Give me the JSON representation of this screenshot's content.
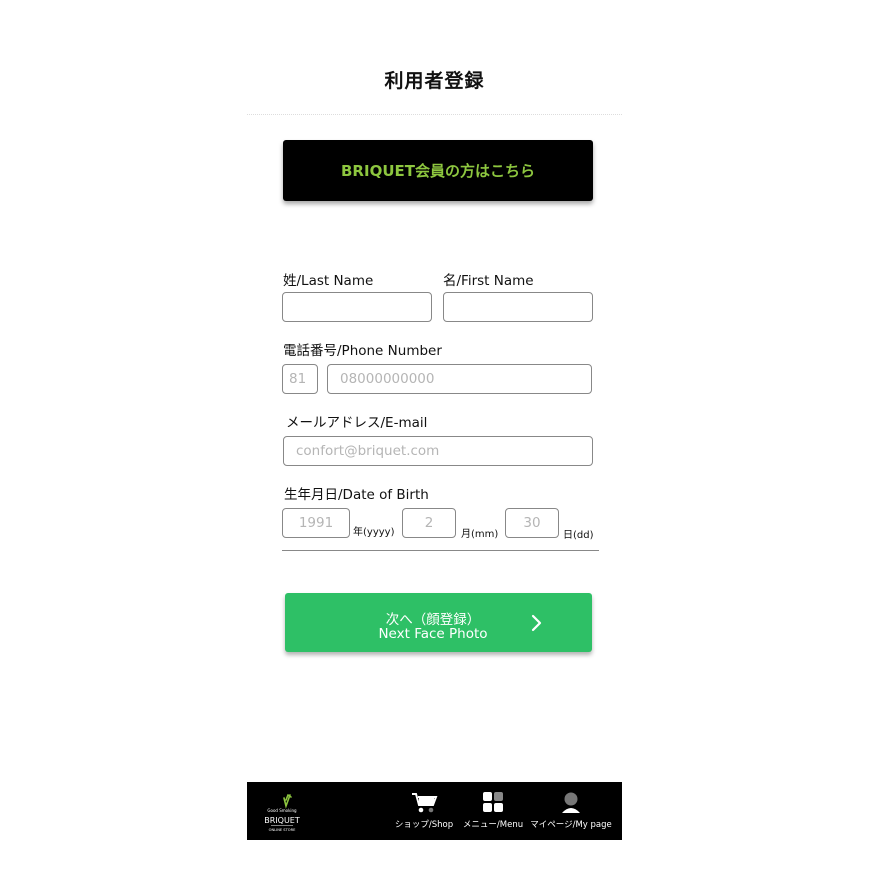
{
  "header": {
    "title": "利用者登録"
  },
  "member_button": {
    "label": "BRIQUET会員の方はこちら"
  },
  "form": {
    "last_name": {
      "label": "姓/Last Name",
      "value": "",
      "placeholder": ""
    },
    "first_name": {
      "label": "名/First Name",
      "value": "",
      "placeholder": ""
    },
    "phone": {
      "label": "電話番号/Phone Number",
      "country_code_placeholder": "81",
      "number_placeholder": "08000000000"
    },
    "email": {
      "label": "メールアドレス/E-mail",
      "placeholder": "confort@briquet.com"
    },
    "birth": {
      "label": "生年月日/Date of Birth",
      "year_placeholder": "1991",
      "year_unit": "年(yyyy)",
      "month_placeholder": "2",
      "month_unit": "月(mm)",
      "day_placeholder": "30",
      "day_unit": "日(dd)"
    }
  },
  "next_button": {
    "label_jp": "次へ（顔登録）",
    "label_en": "Next Face Photo"
  },
  "footer": {
    "logo": {
      "tagline": "Good Smoking",
      "brand": "BRIQUET",
      "sub": "ONLINE STORE"
    },
    "nav": [
      {
        "label": "ショップ/Shop",
        "icon": "cart-icon"
      },
      {
        "label": "メニュー/Menu",
        "icon": "grid-menu-icon"
      },
      {
        "label": "マイページ/My page",
        "icon": "user-icon"
      }
    ]
  },
  "colors": {
    "accent_green": "#2ec066",
    "brand_lime": "#8dc63f",
    "dark": "#000000"
  }
}
